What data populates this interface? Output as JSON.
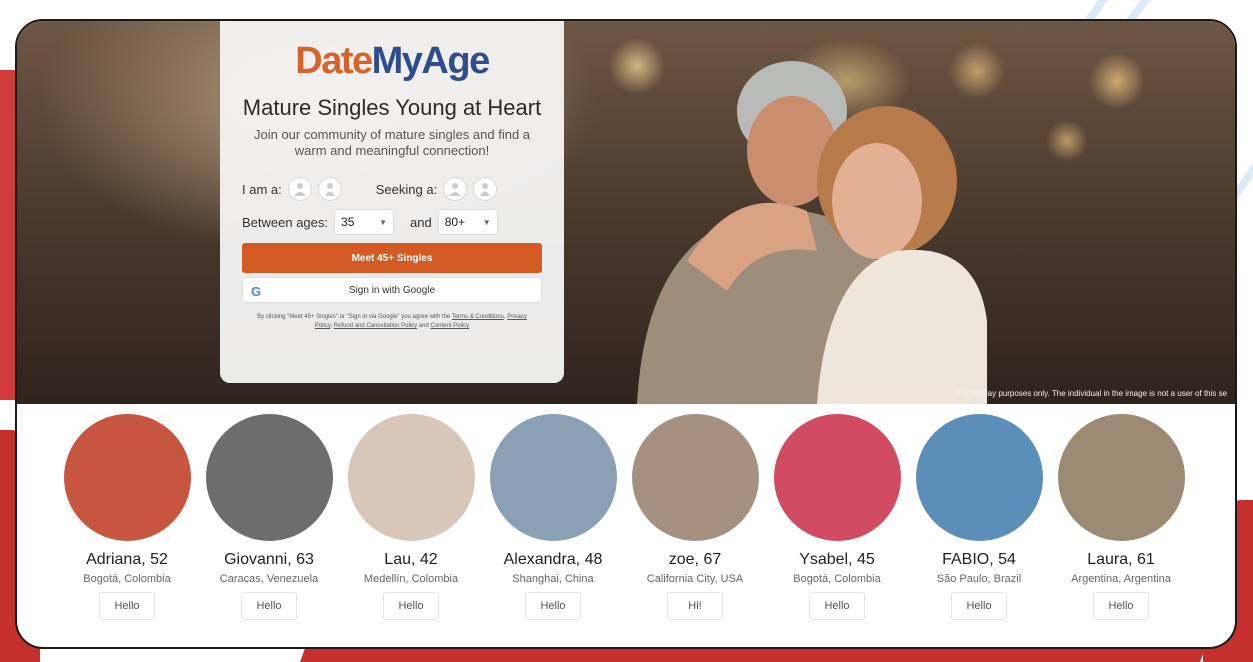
{
  "brand": {
    "logo_part1": "Date",
    "logo_part2": "MyAge",
    "color_orange": "#d9622b",
    "color_blue": "#2d4d8c"
  },
  "hero": {
    "headline": "Mature Singles Young at Heart",
    "subline": "Join our community of mature singles and find a warm and meaningful connection!",
    "disclaimer": "For display purposes only. The individual in the image is not a user of this se"
  },
  "form": {
    "iam_label": "I am a:",
    "seeking_label": "Seeking a:",
    "between_label": "Between ages:",
    "and_label": "and",
    "age_min": "35",
    "age_max": "80+",
    "meet_button": "Meet 45+ Singles",
    "meet_button_color": "#d35a22",
    "google_button": "Sign in with Google",
    "google_icon_letter": "G",
    "legal_intro": "By clicking \"Meet 45+ Singles\" or \"Sign in via Google\" you agree with the",
    "legal_terms": "Terms & Conditions",
    "legal_privacy": "Privacy Policy",
    "legal_refund": "Refund and Cancellation Policy",
    "legal_and": "and",
    "legal_content": "Content Policy"
  },
  "profiles": [
    {
      "name": "Adriana, 52",
      "location": "Bogotá, Colombia",
      "button": "Hello",
      "bg": "#c8553f"
    },
    {
      "name": "Giovanni, 63",
      "location": "Caracas, Venezuela",
      "button": "Hello",
      "bg": "#6d6d6d"
    },
    {
      "name": "Lau, 42",
      "location": "Medellín, Colombia",
      "button": "Hello",
      "bg": "#d8c6b8"
    },
    {
      "name": "Alexandra, 48",
      "location": "Shanghai, China",
      "button": "Hello",
      "bg": "#8aa0b5"
    },
    {
      "name": "zoe, 67",
      "location": "California City, USA",
      "button": "Hi!",
      "bg": "#a69080"
    },
    {
      "name": "Ysabel, 45",
      "location": "Bogotá, Colombia",
      "button": "Hello",
      "bg": "#d14b63"
    },
    {
      "name": "FABIO, 54",
      "location": "São Paulo, Brazil",
      "button": "Hello",
      "bg": "#5b8fb9"
    },
    {
      "name": "Laura, 61",
      "location": "Argentina, Argentina",
      "button": "Hello",
      "bg": "#9c8a74"
    }
  ]
}
